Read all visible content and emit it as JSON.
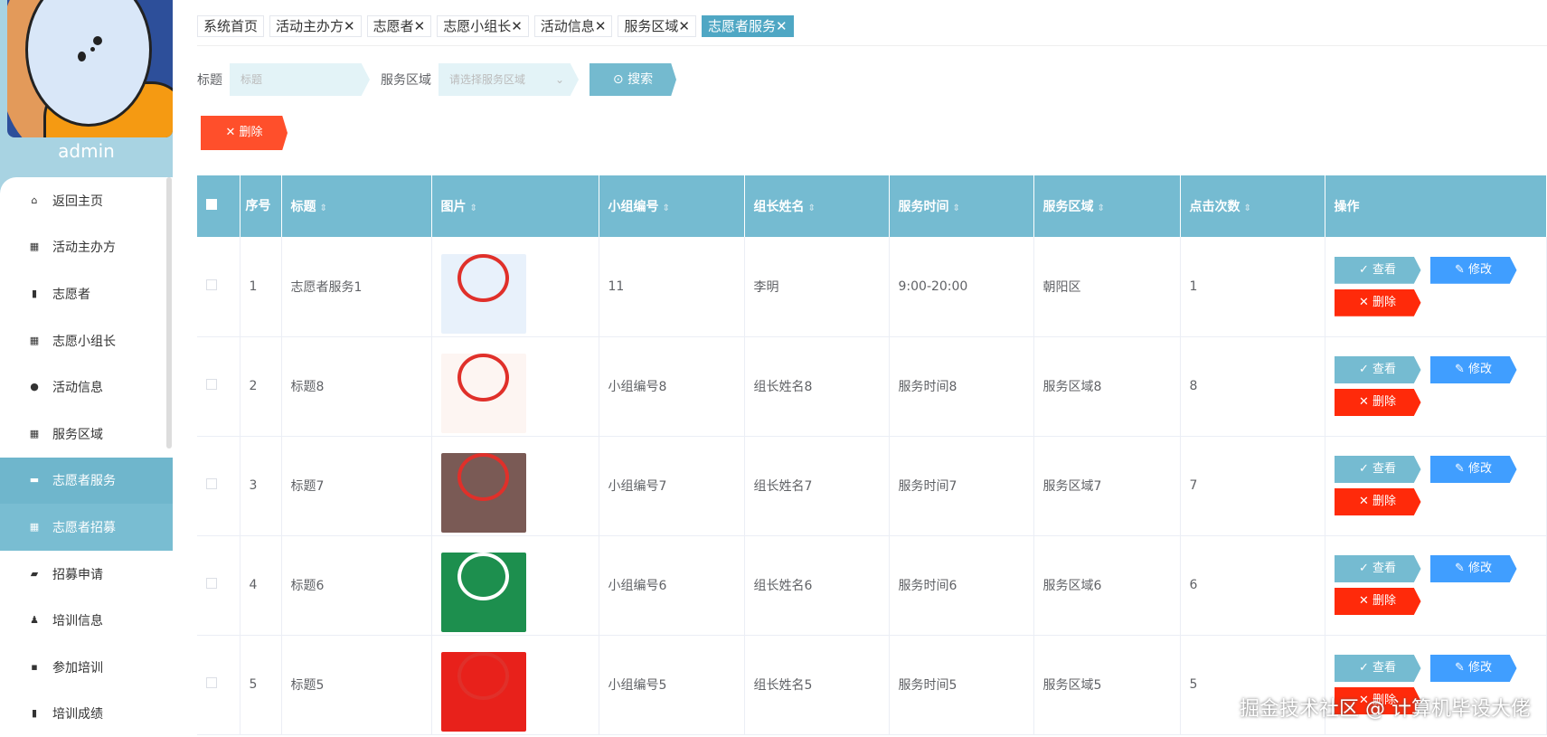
{
  "user": {
    "name": "admin"
  },
  "menu": [
    {
      "label": "返回主页",
      "icon": "home-icon",
      "glyph": "⌂"
    },
    {
      "label": "活动主办方",
      "icon": "grid-icon",
      "glyph": "▦"
    },
    {
      "label": "志愿者",
      "icon": "bars-icon",
      "glyph": "▮"
    },
    {
      "label": "志愿小组长",
      "icon": "grid-icon",
      "glyph": "▦"
    },
    {
      "label": "活动信息",
      "icon": "pin-icon",
      "glyph": "●"
    },
    {
      "label": "服务区域",
      "icon": "grid-icon",
      "glyph": "▦"
    },
    {
      "label": "志愿者服务",
      "icon": "ticket-icon",
      "glyph": "▬"
    },
    {
      "label": "志愿者招募",
      "icon": "grid-icon",
      "glyph": "▦"
    },
    {
      "label": "招募申请",
      "icon": "briefcase-icon",
      "glyph": "▰"
    },
    {
      "label": "培训信息",
      "icon": "user-icon",
      "glyph": "♟"
    },
    {
      "label": "参加培训",
      "icon": "chat-icon",
      "glyph": "▪"
    },
    {
      "label": "培训成绩",
      "icon": "clipboard-icon",
      "glyph": "▮"
    }
  ],
  "tabs": [
    {
      "label": "系统首页",
      "close": ""
    },
    {
      "label": "活动主办方",
      "close": "✕"
    },
    {
      "label": "志愿者",
      "close": "✕"
    },
    {
      "label": "志愿小组长",
      "close": "✕"
    },
    {
      "label": "活动信息",
      "close": "✕"
    },
    {
      "label": "服务区域",
      "close": "✕"
    },
    {
      "label": "志愿者服务",
      "close": "✕"
    }
  ],
  "search": {
    "title_label": "标题",
    "title_placeholder": "标题",
    "area_label": "服务区域",
    "area_placeholder": "请选择服务区域",
    "search_btn": "搜索",
    "delete_btn": "删除"
  },
  "table": {
    "headers": [
      "序号",
      "标题",
      "图片",
      "小组编号",
      "组长姓名",
      "服务时间",
      "服务区域",
      "点击次数",
      "操作"
    ],
    "rows": [
      {
        "no": "1",
        "title": "志愿者服务1",
        "group": "11",
        "leader": "李明",
        "time": "9:00-20:00",
        "area": "朝阳区",
        "clicks": "1",
        "img": "#e8f1fb"
      },
      {
        "no": "2",
        "title": "标题8",
        "group": "小组编号8",
        "leader": "组长姓名8",
        "time": "服务时间8",
        "area": "服务区域8",
        "clicks": "8",
        "img": "#fdf5f2"
      },
      {
        "no": "3",
        "title": "标题7",
        "group": "小组编号7",
        "leader": "组长姓名7",
        "time": "服务时间7",
        "area": "服务区域7",
        "clicks": "7",
        "img": "#7a5a55"
      },
      {
        "no": "4",
        "title": "标题6",
        "group": "小组编号6",
        "leader": "组长姓名6",
        "time": "服务时间6",
        "area": "服务区域6",
        "clicks": "6",
        "img": "#1d8f4e"
      },
      {
        "no": "5",
        "title": "标题5",
        "group": "小组编号5",
        "leader": "组长姓名5",
        "time": "服务时间5",
        "area": "服务区域5",
        "clicks": "5",
        "img": "#e8211b"
      }
    ],
    "actions": {
      "view": "✓ 查看",
      "edit": "✎ 修改",
      "delete": "✕ 删除"
    }
  },
  "watermark": "掘金技术社区 @ 计算机毕设大佬"
}
